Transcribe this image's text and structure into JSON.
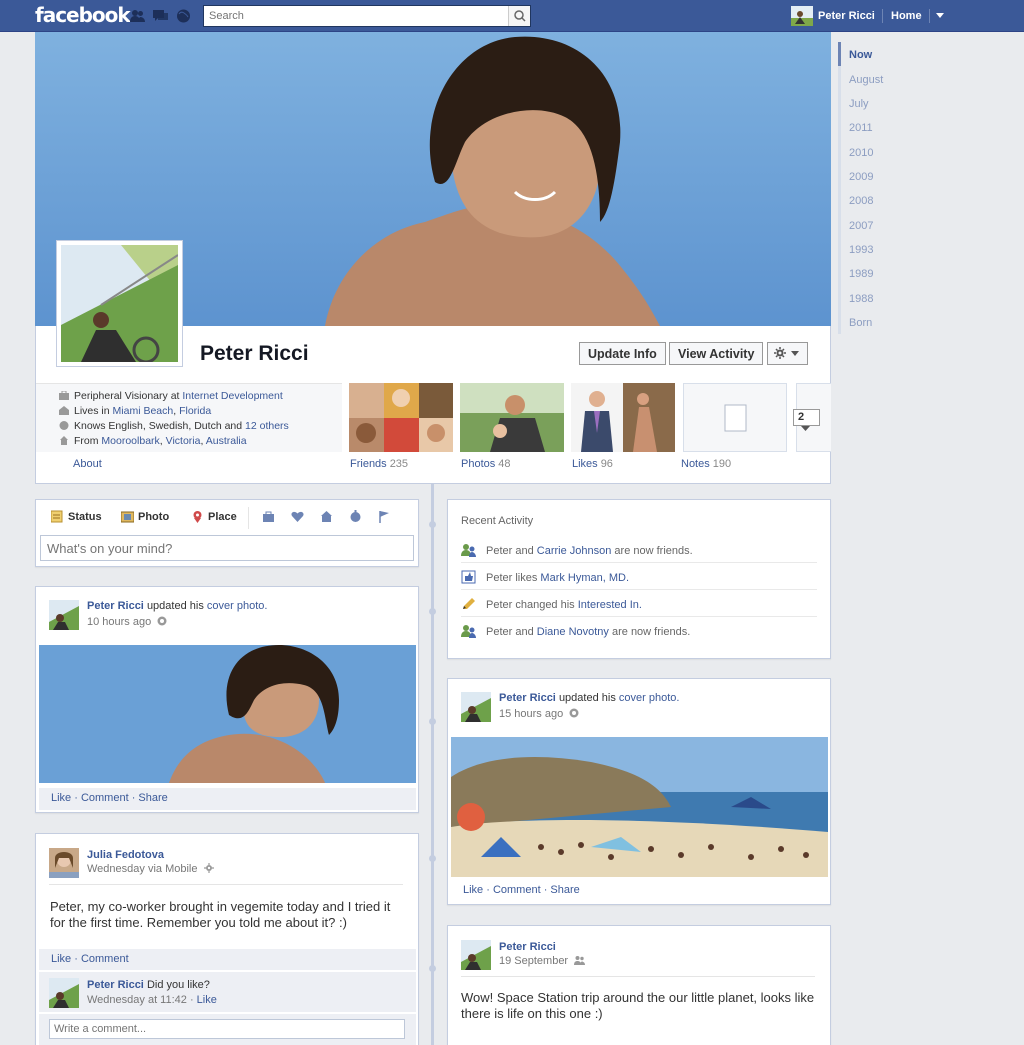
{
  "topbar": {
    "logo": "facebook",
    "search_placeholder": "Search",
    "user_name": "Peter Ricci",
    "home_label": "Home"
  },
  "profile": {
    "name": "Peter Ricci",
    "update_info": "Update Info",
    "view_activity": "View Activity",
    "info": {
      "work_prefix": "Peripheral Visionary at",
      "work_link": "Internet Development",
      "lives_prefix": "Lives in",
      "lives_city": "Miami Beach",
      "lives_state": "Florida",
      "knows_prefix": "Knows English, Swedish, Dutch and",
      "knows_link": "12 others",
      "from_prefix": "From",
      "from_city": "Mooroolbark",
      "from_state": "Victoria",
      "from_country": "Australia"
    },
    "about": "About",
    "boxes": [
      {
        "label": "Friends",
        "count": "235"
      },
      {
        "label": "Photos",
        "count": "48"
      },
      {
        "label": "Likes",
        "count": "96"
      },
      {
        "label": "Notes",
        "count": "190"
      }
    ],
    "more_count": "2"
  },
  "timeline_nav": [
    "Now",
    "August",
    "July",
    "2011",
    "2010",
    "2009",
    "2008",
    "2007",
    "1993",
    "1989",
    "1988",
    "Born"
  ],
  "composer": {
    "tabs": [
      "Status",
      "Photo",
      "Place"
    ],
    "placeholder": "What's on your mind?"
  },
  "recent_activity": {
    "title": "Recent Activity",
    "rows": [
      {
        "pre": "Peter and",
        "link": "Carrie Johnson",
        "post": "are now friends."
      },
      {
        "pre": "Peter likes",
        "link": "Mark Hyman, MD.",
        "post": ""
      },
      {
        "pre": "Peter changed his",
        "link": "Interested In.",
        "post": ""
      },
      {
        "pre": "Peter and",
        "link": "Diane Novotny",
        "post": "are now friends."
      }
    ]
  },
  "posts": {
    "cover1": {
      "author": "Peter Ricci",
      "action": "updated his",
      "link": "cover photo.",
      "time": "10 hours ago",
      "actions": "Like · Comment · Share"
    },
    "cover2": {
      "author": "Peter Ricci",
      "action": "updated his",
      "link": "cover photo.",
      "time": "15 hours ago",
      "actions": "Like · Comment · Share"
    },
    "julia": {
      "author": "Julia Fedotova",
      "time": "Wednesday via Mobile",
      "text": "Peter, my co-worker brought in vegemite today and I tried it for the first time. Remember you told me about it? :)",
      "actions": "Like · Comment",
      "reply_author": "Peter Ricci",
      "reply_text": "Did you like?",
      "reply_time": "Wednesday at 11:42 ·",
      "reply_like": "Like",
      "comment_placeholder": "Write a comment..."
    },
    "space": {
      "author": "Peter Ricci",
      "time": "19 September",
      "text": "Wow! Space Station trip around the our little planet, looks like there is life on this one :)"
    }
  }
}
